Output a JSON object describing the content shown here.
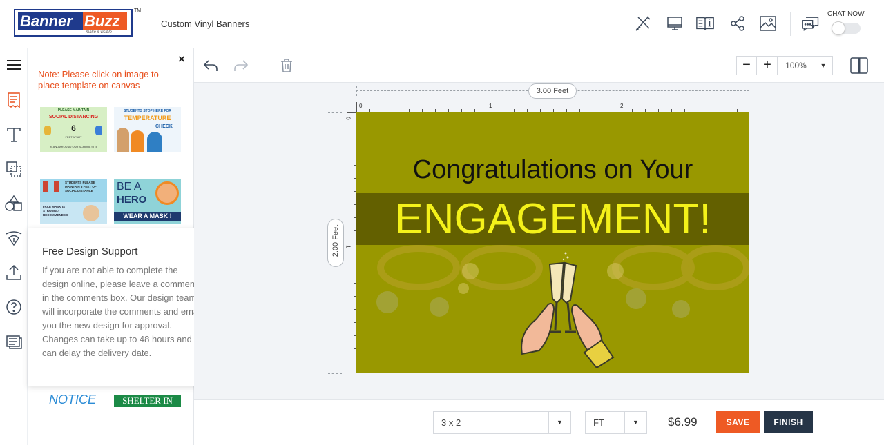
{
  "header": {
    "logo_part1": "Banner",
    "logo_part2": "Buzz",
    "logo_tagline": "make it visible",
    "logo_tm": "TM",
    "product_title": "Custom Vinyl Banners",
    "icons": [
      "design-tools-icon",
      "preview-icon",
      "specs-icon",
      "share-icon",
      "image-icon",
      "chat-icon"
    ],
    "chat_label": "CHAT NOW",
    "chat_enabled": false
  },
  "rail": {
    "icons": [
      "menu-icon",
      "templates-icon",
      "text-icon",
      "background-icon",
      "shapes-icon",
      "clipart-icon",
      "upload-icon",
      "help-icon",
      "comments-icon"
    ]
  },
  "panel": {
    "note": "Note: Please click on image to place template on canvas",
    "templates": [
      {
        "title": "PLEASE MAINTAIN",
        "line2": "SOCIAL DISTANCING",
        "line3": "6",
        "line4": "FEET APART",
        "line5": "IN AND AROUND OUR SCHOOL SITE"
      },
      {
        "title": "STUDENTS STOP HERE FOR",
        "line2": "TEMPERATURE",
        "line3": "CHECK"
      },
      {
        "title": "STUDENTS PLEASE MAINTAIN 6 FEET OF SOCIAL DISTANCE",
        "line2": "FACE MASK IS STRONGLY RECOMMENDED"
      },
      {
        "title": "BE A",
        "line2": "HERO",
        "line3": "WEAR A MASK !"
      },
      {
        "title": "NOTICE"
      },
      {
        "title": "SHELTER IN"
      }
    ]
  },
  "support_popup": {
    "title": "Free Design Support",
    "body": "If you are not able to complete the design online, please leave a comments in the comments box. Our design team will incorporate the comments and email you the new design for approval. Changes can take up to 48 hours and can delay the delivery date."
  },
  "toolbar": {
    "zoom": "100%",
    "zoom_out_label": "−",
    "zoom_in_label": "+",
    "icons": [
      "undo-icon",
      "redo-icon",
      "delete-icon",
      "split-view-icon"
    ]
  },
  "canvas": {
    "width_label": "3.00 Feet",
    "height_label": "2.00 Feet",
    "ruler_top": [
      "0",
      "1",
      "2"
    ],
    "ruler_left": [
      "0",
      "1"
    ],
    "banner_line1": "Congratulations on Your",
    "banner_line2": "ENGAGEMENT!",
    "colors": {
      "background": "#999800",
      "band": "#636000",
      "headline": "#f4f11a"
    }
  },
  "bottom": {
    "size": "3 x 2",
    "unit": "FT",
    "price": "$6.99",
    "save_label": "SAVE",
    "finish_label": "FINISH"
  }
}
